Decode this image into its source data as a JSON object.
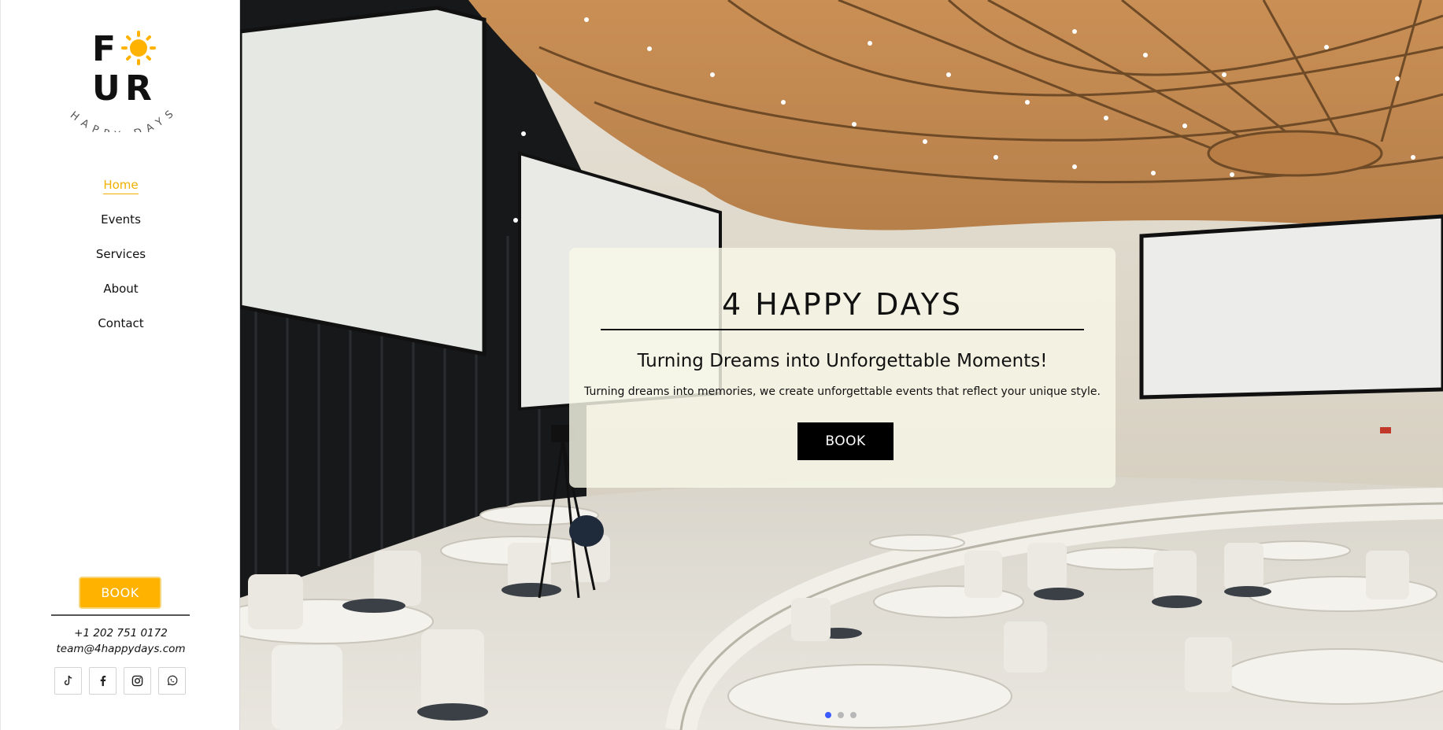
{
  "brand": {
    "logo_letters": [
      "F",
      "U",
      "R"
    ],
    "logo_tagline": "HAPPY DAYS",
    "accent_color": "#ffb300"
  },
  "nav": {
    "items": [
      {
        "label": "Home",
        "active": true
      },
      {
        "label": "Events",
        "active": false
      },
      {
        "label": "Services",
        "active": false
      },
      {
        "label": "About",
        "active": false
      },
      {
        "label": "Contact",
        "active": false
      }
    ]
  },
  "sidebar": {
    "book_label": "BOOK",
    "phone": "+1 202 751 0172",
    "email": "team@4happydays.com",
    "socials": [
      {
        "icon": "tiktok-icon"
      },
      {
        "icon": "facebook-icon"
      },
      {
        "icon": "instagram-icon"
      },
      {
        "icon": "whatsapp-icon"
      }
    ]
  },
  "hero": {
    "title": "4 HAPPY DAYS",
    "subtitle": "Turning Dreams into Unforgettable Moments!",
    "description": "Turning dreams into memories, we create unforgettable events that reflect your unique style.",
    "book_label": "BOOK",
    "slides": {
      "total": 3,
      "active": 1
    },
    "dot_active_color": "#3b5bff",
    "dot_inactive_color": "#b8b8b8"
  }
}
